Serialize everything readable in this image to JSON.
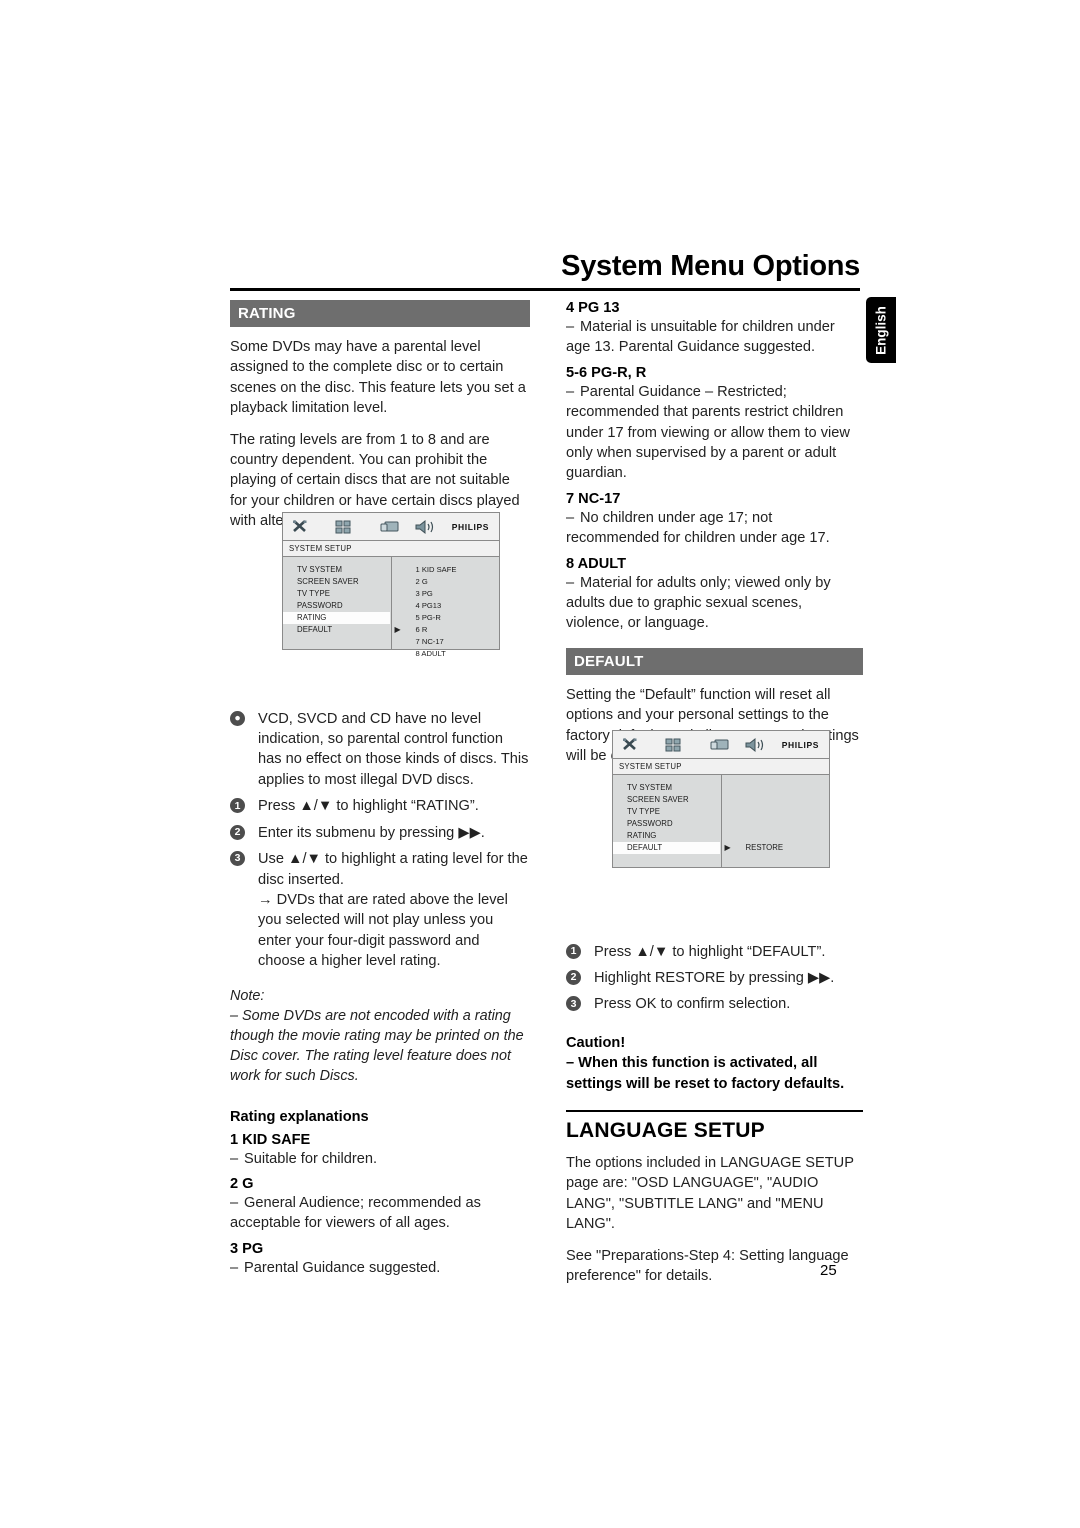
{
  "header": {
    "title": "System Menu Options",
    "language_tab": "English"
  },
  "page_number": "25",
  "left_column": {
    "section_title": "RATING",
    "paragraphs": [
      "Some DVDs may have a parental level assigned to the complete disc or to certain scenes on the disc. This feature lets you set a playback limitation level.",
      "The rating levels are from 1 to 8 and are country dependent. You can prohibit the playing of certain discs that are not suitable for your children or have certain discs played with alternative scenes."
    ],
    "bullet": "VCD, SVCD and CD have no level indication, so parental control function has no effect on those kinds of discs. This applies to most illegal DVD discs.",
    "steps": [
      {
        "num": "1",
        "text": "Press ▲/▼ to highlight “RATING”."
      },
      {
        "num": "2",
        "text": "Enter its submenu by pressing ▶▶."
      },
      {
        "num": "3",
        "text": "Use ▲/▼ to highlight a rating level for the disc inserted.",
        "arrow": "→ DVDs that are rated above the level you selected will not play unless you enter your four-digit password and choose a higher level rating."
      }
    ],
    "note_label": "Note:",
    "note_text": "–  Some DVDs are not encoded with a rating though the movie rating may be printed on the Disc cover. The rating level feature does not work for such Discs.",
    "explanations_title": "Rating explanations",
    "ratings": [
      {
        "label": "1 KID SAFE",
        "desc": "Suitable for children."
      },
      {
        "label": "2 G",
        "desc": "General Audience; recommended as acceptable for viewers of all ages."
      },
      {
        "label": "3 PG",
        "desc": "Parental Guidance suggested."
      }
    ]
  },
  "right_column": {
    "ratings": [
      {
        "label": "4 PG 13",
        "desc": "Material is unsuitable for children under age 13. Parental Guidance suggested."
      },
      {
        "label": "5-6 PG-R, R",
        "desc": "Parental Guidance – Restricted; recommended that parents restrict children under 17 from viewing or allow them to view only when supervised by a parent or adult guardian."
      },
      {
        "label": "7 NC-17",
        "desc": "No children under age 17; not recommended for children under age 17."
      },
      {
        "label": "8 ADULT",
        "desc": "Material for adults only; viewed only by adults due to graphic sexual scenes, violence, or language."
      }
    ],
    "default_section": {
      "title": "DEFAULT",
      "paragraph": "Setting the “Default” function will reset all options and your personal settings to the factory defaults and all your personal settings will be erased.",
      "steps": [
        {
          "num": "1",
          "text": "Press ▲/▼ to highlight “DEFAULT”."
        },
        {
          "num": "2",
          "text": "Highlight RESTORE by pressing ▶▶."
        },
        {
          "num": "3",
          "text": "Press OK to confirm selection."
        }
      ],
      "caution_label": "Caution!",
      "caution_text": "–  When this function is activated, all settings will be reset to factory defaults."
    },
    "language_section": {
      "title": "LANGUAGE SETUP",
      "paragraph1": "The options included in LANGUAGE SETUP page are: \"OSD LANGUAGE\", \"AUDIO LANG\", \"SUBTITLE LANG\" and \"MENU LANG\".",
      "paragraph2": "See \"Preparations-Step 4: Setting language preference\" for details."
    }
  },
  "osd_rating": {
    "title_bar": "SYSTEM SETUP",
    "icons": [
      "tools-icon",
      "grid-icon",
      "tv-icon",
      "speaker-icon"
    ],
    "brand": "PHILIPS",
    "menu_items": [
      "TV SYSTEM",
      "SCREEN SAVER",
      "TV TYPE",
      "PASSWORD",
      "RATING",
      "DEFAULT"
    ],
    "selected_item": "RATING",
    "options": [
      "1 KID SAFE",
      "2 G",
      "3 PG",
      "4 PG13",
      "5 PG-R",
      "6 R",
      "7 NC-17",
      "8 ADULT"
    ],
    "cursor_on": "6 R"
  },
  "osd_default": {
    "title_bar": "SYSTEM SETUP",
    "icons": [
      "tools-icon",
      "grid-icon",
      "tv-icon",
      "speaker-icon"
    ],
    "brand": "PHILIPS",
    "menu_items": [
      "TV SYSTEM",
      "SCREEN SAVER",
      "TV TYPE",
      "PASSWORD",
      "RATING",
      "DEFAULT"
    ],
    "selected_item": "DEFAULT",
    "options": [
      "RESTORE"
    ],
    "cursor_on": "RESTORE"
  },
  "colors": {
    "section_header_bg": "#6e6e6e",
    "osd_bg": "#d9dbdb",
    "osd_chrome": "#f1f1f1",
    "marker": "#4d4d4d"
  }
}
